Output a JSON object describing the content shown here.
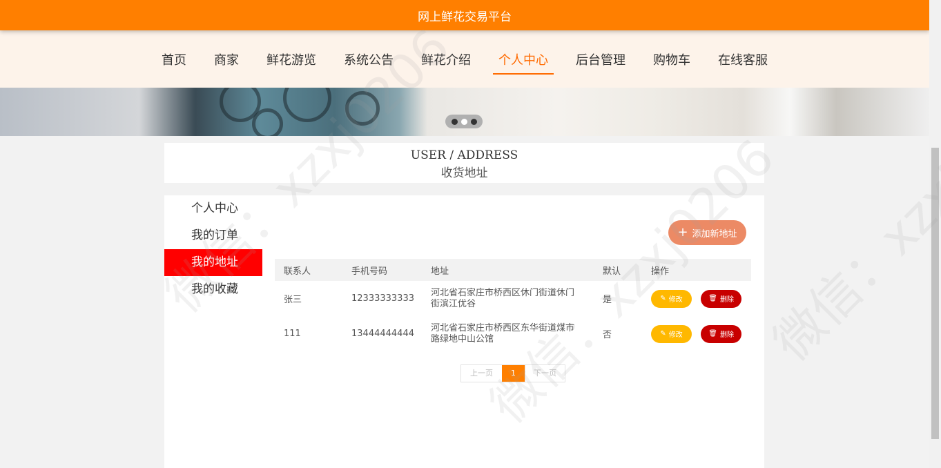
{
  "header": {
    "title": "网上鲜花交易平台"
  },
  "nav": {
    "items": [
      "首页",
      "商家",
      "鲜花游览",
      "系统公告",
      "鲜花介绍",
      "个人中心",
      "后台管理",
      "购物车",
      "在线客服"
    ],
    "active_index": 5
  },
  "carousel": {
    "slide_count": 3,
    "active_slide": 2
  },
  "section": {
    "title_en": "USER / ADDRESS",
    "title_zh": "收货地址"
  },
  "sidebar": {
    "items": [
      "个人中心",
      "我的订单",
      "我的地址",
      "我的收藏"
    ],
    "active_index": 2
  },
  "add_button": {
    "label": "添加新地址",
    "icon": "plus-icon"
  },
  "table": {
    "headers": [
      "联系人",
      "手机号码",
      "地址",
      "默认",
      "操作"
    ],
    "rows": [
      {
        "contact": "张三",
        "phone": "12333333333",
        "address": "河北省石家庄市桥西区休门街道休门街滨江优谷",
        "default": "是"
      },
      {
        "contact": "111",
        "phone": "13444444444",
        "address": "河北省石家庄市桥西区东华街道煤市路绿地中山公馆",
        "default": "否"
      }
    ],
    "edit_label": "修改",
    "delete_label": "删除"
  },
  "pagination": {
    "prev": "上一页",
    "current": "1",
    "next": "下一页"
  },
  "watermark": "微信：xzxj0206",
  "colors": {
    "brand": "#ff7f00",
    "active_menu": "#ff0000",
    "edit": "#ffb800",
    "delete": "#c80000",
    "add": "#ec8a65"
  }
}
